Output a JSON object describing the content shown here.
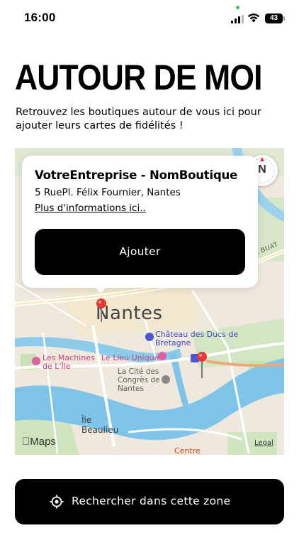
{
  "status_bar": {
    "time": "16:00",
    "battery_level": "43",
    "icons": [
      "signal-icon",
      "wifi-icon",
      "battery-icon"
    ]
  },
  "page": {
    "title": "AUTOUR DE MOI",
    "subtitle": "Retrouvez les boutiques autour de vous ici pour ajouter leurs cartes de fidélités !"
  },
  "map": {
    "labels": {
      "nantes": "Nantes",
      "chateau": "Château des Ducs de Bretagne",
      "machines": "Les Machines de L'Île",
      "lieu_unique": "Le Lieu Unique",
      "cite_congres": "La Cité des Congrès de Nantes",
      "ile_beaulieu": "Île Beaulieu",
      "centre": "Centre",
      "street": "RUE DU GÉNÉRAL BUAT"
    },
    "attribution": "Maps",
    "legal": "Legal",
    "compass_label": "N",
    "colors": {
      "land": "#efe9dd",
      "water": "#7ec4e8",
      "park": "#c5e3b0",
      "road": "#ffffff",
      "pin": "#e53935"
    }
  },
  "popup": {
    "title": "VotreEntreprise - NomBoutique",
    "address": "5 RuePl. Félix Fournier, Nantes",
    "link": "Plus d'informations ici..",
    "add_button": "Ajouter"
  },
  "bottom": {
    "search_zone_button": "Rechercher dans cette zone",
    "icon": "location-target-icon"
  }
}
